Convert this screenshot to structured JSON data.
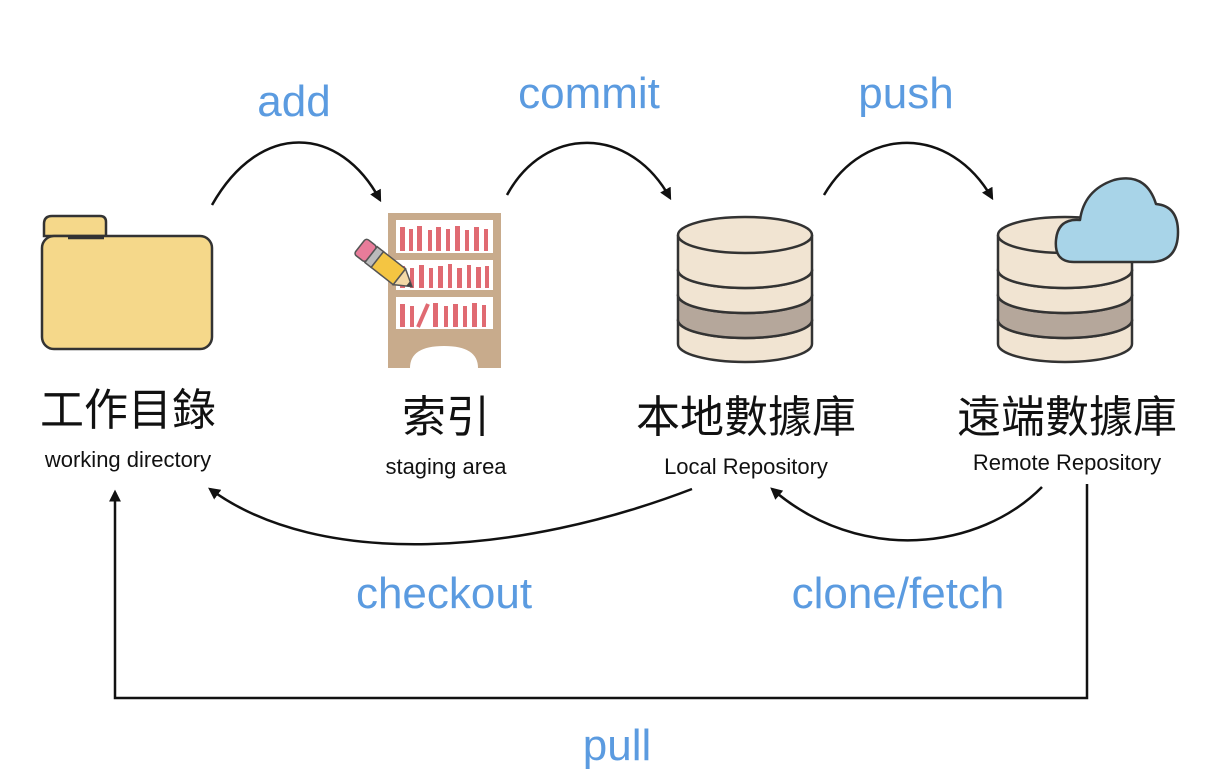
{
  "operations": {
    "add": "add",
    "commit": "commit",
    "push": "push",
    "checkout": "checkout",
    "clone_fetch": "clone/fetch",
    "pull": "pull"
  },
  "nodes": {
    "working": {
      "zh": "工作目錄",
      "en": "working directory",
      "icon": "folder-icon"
    },
    "staging": {
      "zh": "索引",
      "en": "staging area",
      "icon": "bookshelf-icon"
    },
    "local": {
      "zh": "本地數據庫",
      "en": "Local Repository",
      "icon": "database-icon"
    },
    "remote": {
      "zh": "遠端數據庫",
      "en": "Remote Repository",
      "icon": "cloud-database-icon"
    }
  },
  "colors": {
    "operation_text": "#5b9be0",
    "arrow": "#111111",
    "folder": "#f5d88a",
    "db_light": "#f1e4d2",
    "db_dark": "#b5a79b",
    "cloud": "#a8d4e8",
    "shelf": "#c8ab8c",
    "book": "#e06a72"
  }
}
